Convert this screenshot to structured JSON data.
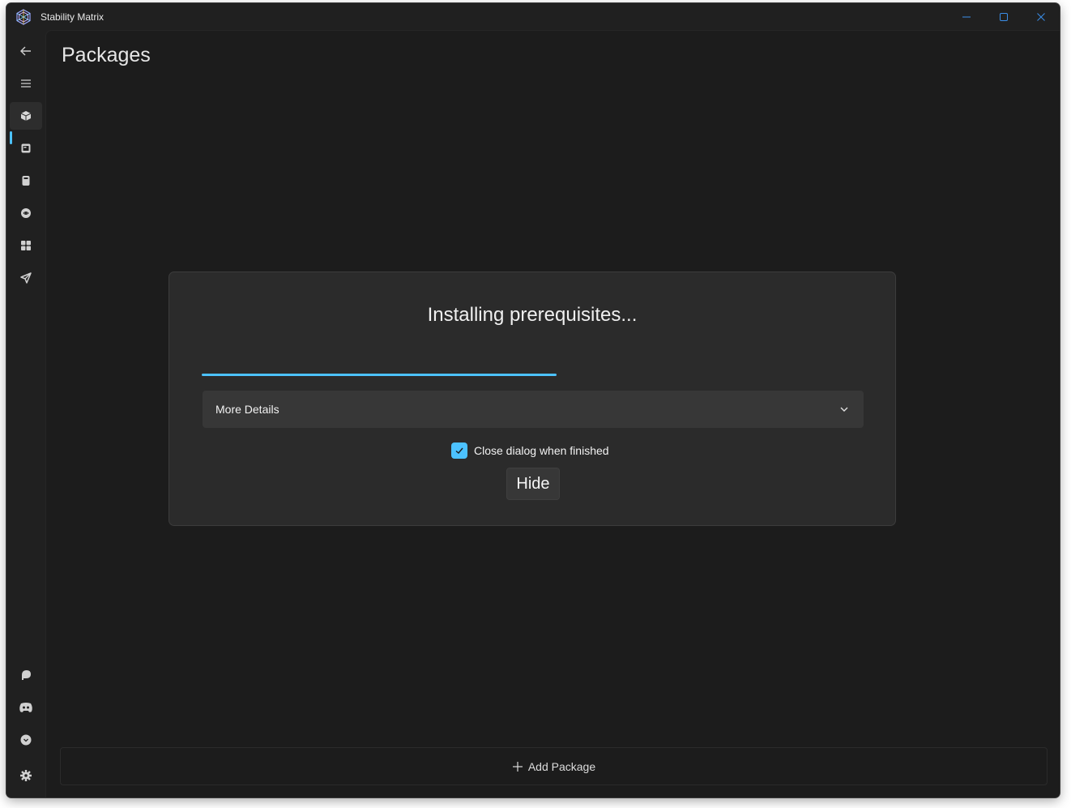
{
  "window": {
    "title": "Stability Matrix",
    "accent_color": "#4cc2ff",
    "controls": [
      "minimize-icon",
      "maximize-icon",
      "close-icon"
    ]
  },
  "sidebar": {
    "top_items": [
      {
        "name": "back",
        "icon": "back-arrow-icon"
      },
      {
        "name": "menu",
        "icon": "hamburger-menu-icon"
      },
      {
        "name": "packages",
        "icon": "package-box-icon",
        "selected": true
      },
      {
        "name": "inference",
        "icon": "image-frame-icon"
      },
      {
        "name": "checkpoints",
        "icon": "notebook-icon"
      },
      {
        "name": "model-browser",
        "icon": "brain-icon"
      },
      {
        "name": "outputs",
        "icon": "grid-apps-icon"
      },
      {
        "name": "workflows",
        "icon": "send-icon"
      }
    ],
    "bottom_items": [
      {
        "name": "patreon",
        "icon": "patreon-icon"
      },
      {
        "name": "discord",
        "icon": "discord-icon"
      },
      {
        "name": "download",
        "icon": "download-circle-icon"
      },
      {
        "name": "settings",
        "icon": "gear-icon"
      }
    ]
  },
  "page": {
    "title": "Packages",
    "add_package_label": "Add Package"
  },
  "dialog": {
    "title": "Installing prerequisites...",
    "progress_percent": 53.5,
    "details_label": "More Details",
    "close_when_finished_label": "Close dialog when finished",
    "close_when_finished_checked": true,
    "hide_label": "Hide"
  }
}
